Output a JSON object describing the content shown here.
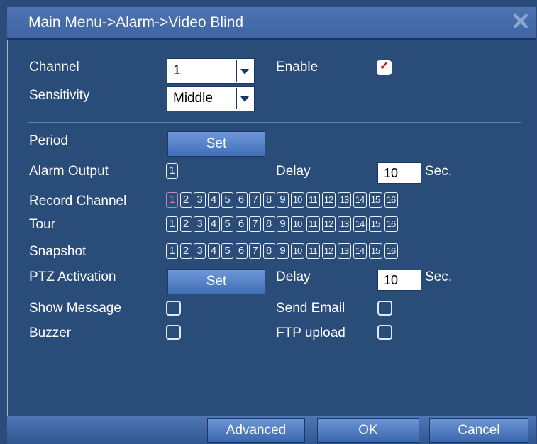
{
  "window": {
    "title": "Main Menu->Alarm->Video Blind",
    "close_icon": "close-icon"
  },
  "form": {
    "channel_label": "Channel",
    "channel_value": "1",
    "enable_label": "Enable",
    "enable_checked": true,
    "sensitivity_label": "Sensitivity",
    "sensitivity_value": "Middle",
    "period_label": "Period",
    "period_button": "Set",
    "alarm_output_label": "Alarm Output",
    "alarm_output_value": "1",
    "delay_label": "Delay",
    "delay_value": "10",
    "delay_unit": "Sec.",
    "record_channel_label": "Record Channel",
    "tour_label": "Tour",
    "snapshot_label": "Snapshot",
    "channels": [
      "1",
      "2",
      "3",
      "4",
      "5",
      "6",
      "7",
      "8",
      "9",
      "10",
      "11",
      "12",
      "13",
      "14",
      "15",
      "16"
    ],
    "record_channel_selected": [
      "1"
    ],
    "ptz_label": "PTZ Activation",
    "ptz_button": "Set",
    "ptz_delay_label": "Delay",
    "ptz_delay_value": "10",
    "ptz_delay_unit": "Sec.",
    "show_message_label": "Show Message",
    "send_email_label": "Send Email",
    "buzzer_label": "Buzzer",
    "ftp_upload_label": "FTP upload"
  },
  "footer": {
    "advanced": "Advanced",
    "ok": "OK",
    "cancel": "Cancel"
  },
  "colors": {
    "panel": "#2a4c79",
    "title_bar": "#4d73b0",
    "text": "#ffffff",
    "check_mark": "#e00000"
  }
}
